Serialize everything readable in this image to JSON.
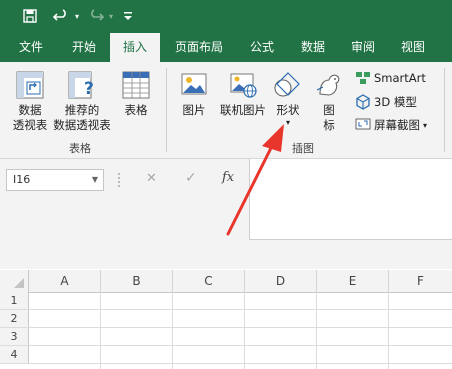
{
  "titlebar": {
    "save_icon": "save-icon",
    "undo_icon": "undo-icon",
    "redo_icon": "redo-icon",
    "customize_icon": "customize-quick-access-icon"
  },
  "tabs": [
    {
      "label": "文件"
    },
    {
      "label": "开始"
    },
    {
      "label": "插入",
      "active": true
    },
    {
      "label": "页面布局"
    },
    {
      "label": "公式"
    },
    {
      "label": "数据"
    },
    {
      "label": "审阅"
    },
    {
      "label": "视图"
    }
  ],
  "ribbon": {
    "tables": {
      "pivot": {
        "line1": "数据",
        "line2": "透视表"
      },
      "recommended": {
        "line1": "推荐的",
        "line2": "数据透视表"
      },
      "table": {
        "label": "表格"
      },
      "group_label": "表格"
    },
    "illustrations": {
      "pictures": {
        "label": "图片"
      },
      "online": {
        "label": "联机图片"
      },
      "shapes": {
        "label": "形状"
      },
      "icons": {
        "line1": "图",
        "line2": "标"
      },
      "smartart": {
        "label": "SmartArt"
      },
      "model3d": {
        "label": "3D 模型"
      },
      "screenshot": {
        "label": "屏幕截图"
      },
      "group_label": "插图"
    }
  },
  "formula_bar": {
    "name_box": "I16",
    "cancel": "✕",
    "enter": "✓",
    "fx": "fx"
  },
  "grid": {
    "columns": [
      "A",
      "B",
      "C",
      "D",
      "E",
      "F"
    ],
    "rows": [
      "1",
      "2",
      "3",
      "4"
    ]
  },
  "colors": {
    "brand": "#217346",
    "arrow": "#e8362c"
  }
}
